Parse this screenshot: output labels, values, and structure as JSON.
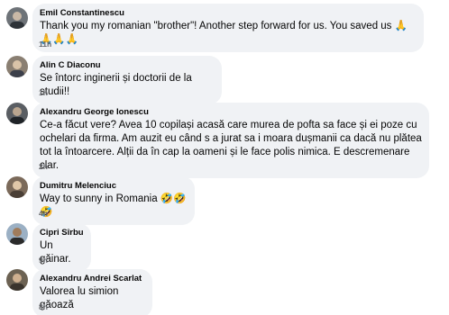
{
  "comments": [
    {
      "author": "Emil Constantinescu",
      "text": "Thank you my romanian \"brother\"! Another step forward for us. You saved us 🙏🙏🙏🙏",
      "time": "11h"
    },
    {
      "author": "Alin C Diaconu",
      "text": "Se întorc inginerii și doctorii de la studii!!",
      "time": "1h"
    },
    {
      "author": "Alexandru George Ionescu",
      "text": "Ce-a făcut vere? Avea 10 copilași acasă care murea de pofta sa face și ei poze cu ochelari da firma. Am auzit eu când s a jurat sa i moara dușmanii ca dacă nu plătea tot la întoarcere. Alții da în cap la oameni și le face polis nimica. E descremenare clar.",
      "time": "2h"
    },
    {
      "author": "Dumitru Melenciuc",
      "text": "Way to sunny in Romania 🤣🤣🤣",
      "time": "4h"
    },
    {
      "author": "Cipri Sîrbu",
      "text": "Un găinar.",
      "time": "9h"
    },
    {
      "author": "Alexandru Andrei Scarlat",
      "text": "Valorea lu simion găoază",
      "time": "8h"
    }
  ]
}
